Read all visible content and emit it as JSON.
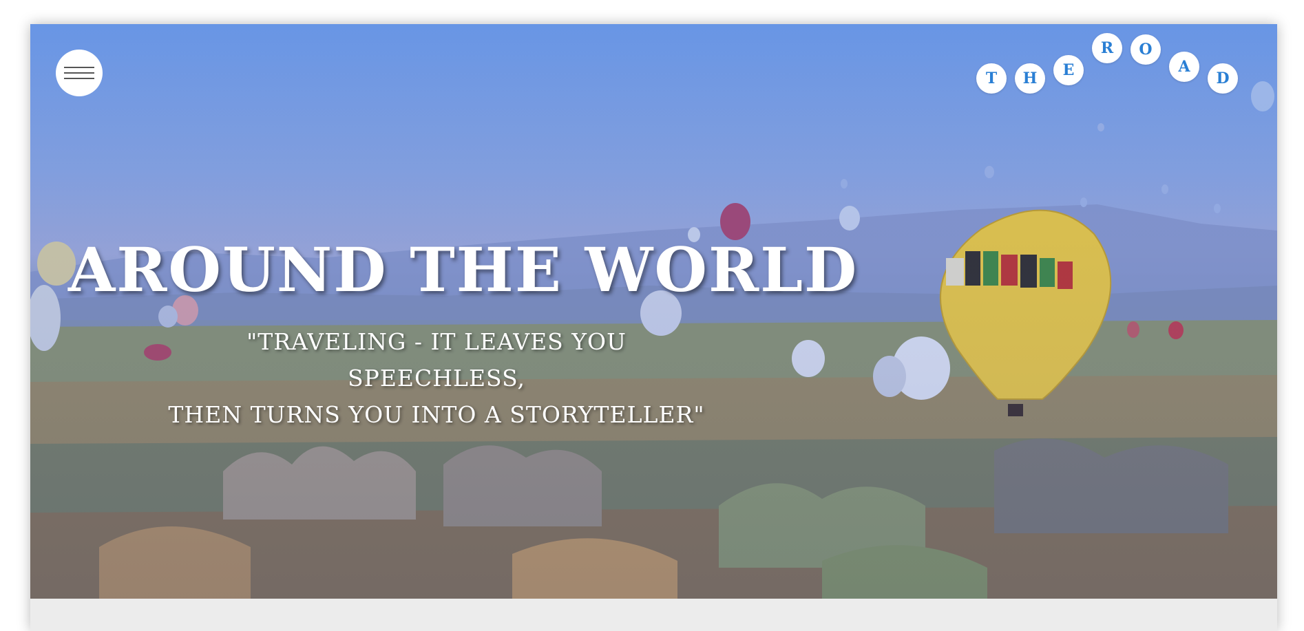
{
  "header": {
    "menu_icon": "hamburger-icon",
    "logo_letters": [
      "T",
      "H",
      "E",
      "R",
      "O",
      "A",
      "D"
    ]
  },
  "hero": {
    "title": "AROUND THE WORLD",
    "quote_line1": "\"TRAVELING - IT LEAVES YOU SPEECHLESS,",
    "quote_line2": "THEN TURNS YOU INTO A STORYTELLER\"",
    "image": "hot-air-balloons-landscape"
  },
  "colors": {
    "logo_letter": "#2a7fd4",
    "logo_circle": "#ffffff",
    "headline": "#ffffff"
  }
}
